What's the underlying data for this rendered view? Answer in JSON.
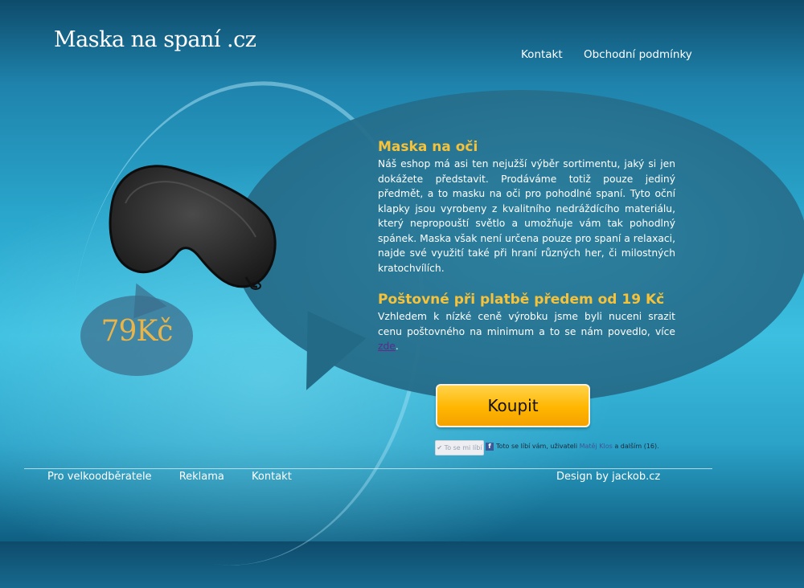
{
  "site": {
    "logo": "Maska na spaní .cz"
  },
  "top_nav": [
    {
      "label": "Kontakt"
    },
    {
      "label": "Obchodní podmínky"
    }
  ],
  "product": {
    "price": "79Kč",
    "section1_title": "Maska na oči",
    "section1_text": "Náš eshop má asi ten nejužší výběr sortimentu, jaký si jen dokážete představit. Prodáváme totiž pouze jediný předmět, a to masku na oči pro pohodlné spaní. Tyto oční klapky jsou vyrobeny z kvalitního nedráždícího materiálu, který nepropouští světlo a umožňuje vám tak pohodlný spánek. Maska však není určena pouze pro spaní a relaxaci, najde své využití také při hraní různých her, či milostných kratochvílích.",
    "section2_title": "Poštovné při platbě předem od 19 Kč",
    "section2_text": "Vzhledem k nízké ceně výrobku jsme byli nuceni srazit cenu poštovného na minimum a to se nám povedlo, více ",
    "section2_link": "zde",
    "section2_end": ".",
    "buy_label": "Koupit"
  },
  "social": {
    "like_button": "✔ To se mi líbí",
    "fb_icon": "f",
    "like_prefix": "Toto se líbí vám, uživateli ",
    "like_user": "Matěj Klos",
    "like_suffix": " a dalším (16)."
  },
  "footer": {
    "links": [
      {
        "label": "Pro velkoodběratele"
      },
      {
        "label": "Reklama"
      },
      {
        "label": "Kontakt"
      }
    ],
    "credit": "Design by jackob.cz"
  },
  "colors": {
    "accent": "#f5c23a",
    "price": "#e9b44a",
    "buy_button": "#ffb600",
    "link": "#5b2c8d"
  }
}
